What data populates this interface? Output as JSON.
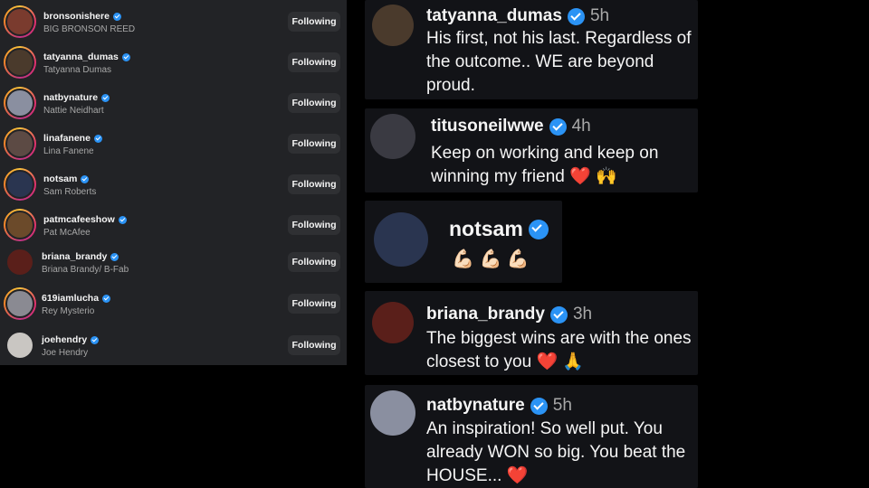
{
  "following_list": {
    "button_label": "Following",
    "rows": [
      {
        "username": "bronsonishere",
        "name": "BIG BRONSON REED",
        "avatar_color": "#7a3b2e",
        "story_ring": true
      },
      {
        "username": "tatyanna_dumas",
        "name": "Tatyanna Dumas",
        "avatar_color": "#4a3a2c",
        "story_ring": true
      },
      {
        "username": "natbynature",
        "name": "Nattie Neidhart",
        "avatar_color": "#8a8fa0",
        "story_ring": true
      },
      {
        "username": "linafanene",
        "name": "Lina Fanene",
        "avatar_color": "#5c4a44",
        "story_ring": true
      },
      {
        "username": "notsam",
        "name": "Sam Roberts",
        "avatar_color": "#2a3550",
        "story_ring": true
      },
      {
        "username": "patmcafeeshow",
        "name": "Pat McAfee",
        "avatar_color": "#6b4a2a",
        "story_ring": true
      },
      {
        "username": "briana_brandy",
        "name": "Briana Brandy/ B-Fab",
        "avatar_color": "#5a1f1a",
        "story_ring": false
      },
      {
        "username": "619iamlucha",
        "name": "Rey Mysterio",
        "avatar_color": "#8a8a92",
        "story_ring": true
      },
      {
        "username": "joehendry",
        "name": "Joe Hendry",
        "avatar_color": "#c9c6c2",
        "story_ring": false
      }
    ]
  },
  "comments": [
    {
      "username": "tatyanna_dumas",
      "time": "5h",
      "text": "His first, not his last. Regardless of\nthe outcome.. WE are beyond\nproud.",
      "avatar_color": "#4a3a2c"
    },
    {
      "username": "titusoneilwwe",
      "time": "4h",
      "text": "Keep on working and keep on\nwinning my friend",
      "emoji": "❤️ 🙌",
      "avatar_color": "#3a3a42"
    },
    {
      "username": "notsam",
      "time": "",
      "text": "",
      "emoji": "💪🏻 💪🏻 💪🏻",
      "avatar_color": "#2a3550"
    },
    {
      "username": "briana_brandy",
      "time": "3h",
      "text": "The biggest wins are with the ones\nclosest to you",
      "emoji": "❤️ 🙏",
      "avatar_color": "#5a1f1a"
    },
    {
      "username": "natbynature",
      "time": "5h",
      "text": "An inspiration! So well put. You\nalready WON so big. You beat the\nHOUSE...",
      "emoji": "❤️",
      "avatar_color": "#8a8fa0"
    }
  ]
}
